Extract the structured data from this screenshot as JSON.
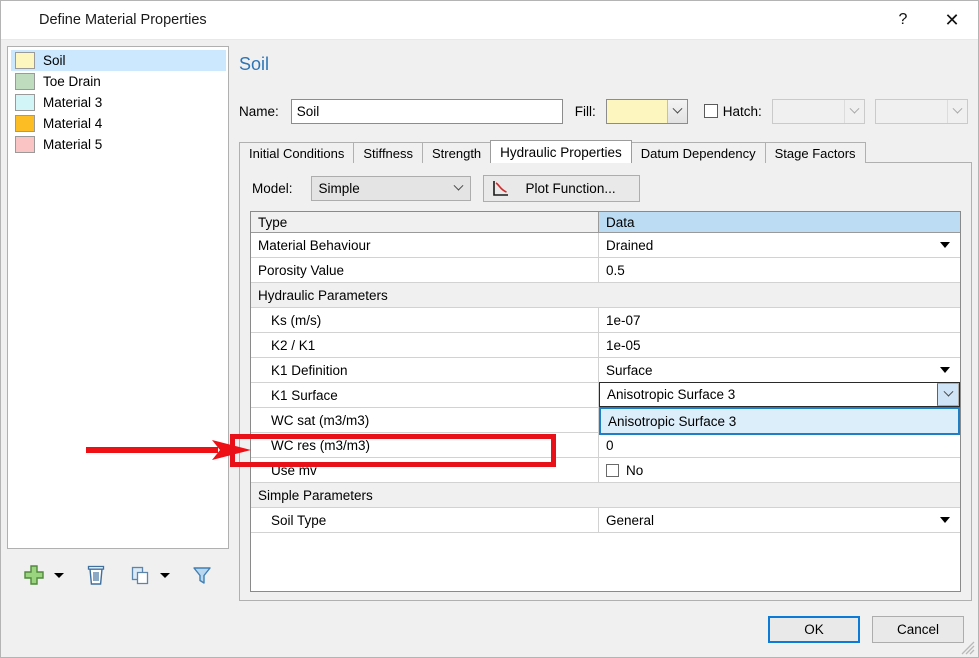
{
  "window": {
    "title": "Define Material Properties",
    "help_label": "?",
    "close_label": "✕"
  },
  "materials": {
    "items": [
      {
        "label": "Soil",
        "color": "#fdf6bf",
        "selected": true
      },
      {
        "label": "Toe Drain",
        "color": "#bfdcbe",
        "selected": false
      },
      {
        "label": "Material 3",
        "color": "#d2f5f8",
        "selected": false
      },
      {
        "label": "Material 4",
        "color": "#fcbd24",
        "selected": false
      },
      {
        "label": "Material 5",
        "color": "#fac3c4",
        "selected": false
      }
    ],
    "toolbar": {
      "add_icon": "plus-icon",
      "add_caret": "caret-down-icon",
      "delete_icon": "trash-icon",
      "copy_icon": "copy-icon",
      "copy_caret": "caret-down-icon",
      "filter_icon": "funnel-icon"
    }
  },
  "detail": {
    "heading": "Soil",
    "name_label": "Name:",
    "name_value": "Soil",
    "fill_label": "Fill:",
    "fill_color": "#fdf6bf",
    "hatch_label": "Hatch:",
    "hatch_checked": false
  },
  "tabs": [
    {
      "label": "Initial Conditions",
      "active": false
    },
    {
      "label": "Stiffness",
      "active": false
    },
    {
      "label": "Strength",
      "active": false
    },
    {
      "label": "Hydraulic Properties",
      "active": true
    },
    {
      "label": "Datum Dependency",
      "active": false
    },
    {
      "label": "Stage Factors",
      "active": false
    }
  ],
  "hydraulic": {
    "model_label": "Model:",
    "model_value": "Simple",
    "plot_button": "Plot Function...",
    "plot_icon": "curve-plot-icon",
    "columns": {
      "type": "Type",
      "data": "Data"
    },
    "rows": [
      {
        "kind": "row",
        "type": "Material Behaviour",
        "data": "Drained",
        "dropdown": true,
        "indent": false
      },
      {
        "kind": "row",
        "type": "Porosity Value",
        "data": "0.5",
        "dropdown": false,
        "indent": false
      },
      {
        "kind": "section",
        "type": "Hydraulic Parameters",
        "data": "",
        "dropdown": false,
        "indent": false
      },
      {
        "kind": "row",
        "type": "Ks (m/s)",
        "data": "1e-07",
        "dropdown": false,
        "indent": true
      },
      {
        "kind": "row",
        "type": "K2 / K1",
        "data": "1e-05",
        "dropdown": false,
        "indent": true
      },
      {
        "kind": "row",
        "type": "K1 Definition",
        "data": "Surface",
        "dropdown": true,
        "indent": true
      },
      {
        "kind": "active",
        "type": "K1 Surface",
        "data": "Anisotropic Surface 3",
        "dropdown": true,
        "indent": true
      },
      {
        "kind": "row",
        "type": "WC sat (m3/m3)",
        "data": "",
        "dropdown": false,
        "indent": true
      },
      {
        "kind": "row",
        "type": "WC res (m3/m3)",
        "data": "0",
        "dropdown": false,
        "indent": true
      },
      {
        "kind": "check",
        "type": "Use mv",
        "data": "No",
        "dropdown": false,
        "indent": true
      },
      {
        "kind": "section",
        "type": "Simple Parameters",
        "data": "",
        "dropdown": false,
        "indent": false
      },
      {
        "kind": "row",
        "type": "Soil Type",
        "data": "General",
        "dropdown": true,
        "indent": true
      }
    ],
    "open_dropdown": {
      "selected_value": "Anisotropic Surface 3",
      "options": [
        "Anisotropic Surface 3"
      ]
    }
  },
  "footer": {
    "ok_label": "OK",
    "cancel_label": "Cancel"
  },
  "annotation": {
    "arrow_color": "#ee1015",
    "highlight_color": "#e8111a",
    "target_row": "K1 Surface"
  }
}
